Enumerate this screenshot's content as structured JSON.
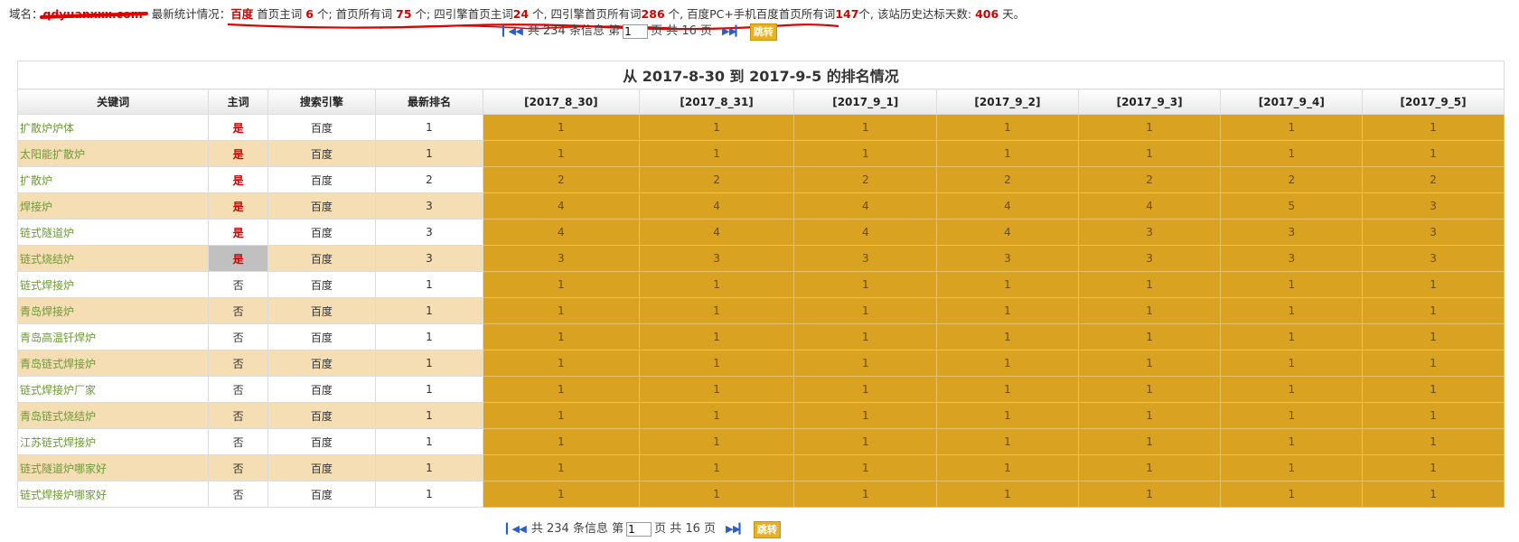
{
  "stats": {
    "domain_label": "域名：",
    "domain_value": "qdyuanxxx.com",
    "latest_label": "最新统计情况：",
    "engine": "百度",
    "seg1_text": "首页主词",
    "seg1_value": "6",
    "seg1_unit": "个; 首页所有词",
    "seg2_value": "75",
    "seg2_unit": "个; 四引擎首页主词",
    "seg3_value": "24",
    "seg3_unit": "个, 四引擎首页所有词",
    "seg4_value": "286",
    "seg4_unit": "个, 百度PC+手机百度首页所有词",
    "seg5_value": "147",
    "seg5_unit": "个, 该站历史达标天数:",
    "days_value": "406",
    "days_unit": "天。"
  },
  "pager": {
    "total_prefix": "共 234 条信息 第",
    "page_value": "1",
    "page_suffix": "页 共 16 页",
    "go_label": "跳转"
  },
  "table": {
    "caption": "从 2017-8-30 到 2017-9-5 的排名情况",
    "headers": [
      "关键词",
      "主词",
      "搜索引擎",
      "最新排名",
      "[2017_8_30]",
      "[2017_8_31]",
      "[2017_9_1]",
      "[2017_9_2]",
      "[2017_9_3]",
      "[2017_9_4]",
      "[2017_9_5]"
    ],
    "rows": [
      {
        "keyword": "扩散炉炉体",
        "main": "是",
        "engine": "百度",
        "latest": "1",
        "days": [
          "1",
          "1",
          "1",
          "1",
          "1",
          "1",
          "1"
        ]
      },
      {
        "keyword": "太阳能扩散炉",
        "main": "是",
        "engine": "百度",
        "latest": "1",
        "days": [
          "1",
          "1",
          "1",
          "1",
          "1",
          "1",
          "1"
        ]
      },
      {
        "keyword": "扩散炉",
        "main": "是",
        "engine": "百度",
        "latest": "2",
        "days": [
          "2",
          "2",
          "2",
          "2",
          "2",
          "2",
          "2"
        ]
      },
      {
        "keyword": "焊接炉",
        "main": "是",
        "engine": "百度",
        "latest": "3",
        "days": [
          "4",
          "4",
          "4",
          "4",
          "4",
          "5",
          "3"
        ]
      },
      {
        "keyword": "链式隧道炉",
        "main": "是",
        "engine": "百度",
        "latest": "3",
        "days": [
          "4",
          "4",
          "4",
          "4",
          "3",
          "3",
          "3"
        ]
      },
      {
        "keyword": "链式烧结炉",
        "main": "是",
        "engine": "百度",
        "latest": "3",
        "days": [
          "3",
          "3",
          "3",
          "3",
          "3",
          "3",
          "3"
        ]
      },
      {
        "keyword": "链式焊接炉",
        "main": "否",
        "engine": "百度",
        "latest": "1",
        "days": [
          "1",
          "1",
          "1",
          "1",
          "1",
          "1",
          "1"
        ]
      },
      {
        "keyword": "青岛焊接炉",
        "main": "否",
        "engine": "百度",
        "latest": "1",
        "days": [
          "1",
          "1",
          "1",
          "1",
          "1",
          "1",
          "1"
        ]
      },
      {
        "keyword": "青岛高温钎焊炉",
        "main": "否",
        "engine": "百度",
        "latest": "1",
        "days": [
          "1",
          "1",
          "1",
          "1",
          "1",
          "1",
          "1"
        ]
      },
      {
        "keyword": "青岛链式焊接炉",
        "main": "否",
        "engine": "百度",
        "latest": "1",
        "days": [
          "1",
          "1",
          "1",
          "1",
          "1",
          "1",
          "1"
        ]
      },
      {
        "keyword": "链式焊接炉厂家",
        "main": "否",
        "engine": "百度",
        "latest": "1",
        "days": [
          "1",
          "1",
          "1",
          "1",
          "1",
          "1",
          "1"
        ]
      },
      {
        "keyword": "青岛链式烧结炉",
        "main": "否",
        "engine": "百度",
        "latest": "1",
        "days": [
          "1",
          "1",
          "1",
          "1",
          "1",
          "1",
          "1"
        ]
      },
      {
        "keyword": "江苏链式焊接炉",
        "main": "否",
        "engine": "百度",
        "latest": "1",
        "days": [
          "1",
          "1",
          "1",
          "1",
          "1",
          "1",
          "1"
        ]
      },
      {
        "keyword": "链式隧道炉哪家好",
        "main": "否",
        "engine": "百度",
        "latest": "1",
        "days": [
          "1",
          "1",
          "1",
          "1",
          "1",
          "1",
          "1"
        ]
      },
      {
        "keyword": "链式焊接炉哪家好",
        "main": "否",
        "engine": "百度",
        "latest": "1",
        "days": [
          "1",
          "1",
          "1",
          "1",
          "1",
          "1",
          "1"
        ]
      }
    ]
  },
  "colors": {
    "accent_red": "#d40000",
    "rank_cell": "#d9a321",
    "alt_row": "#f5deb3",
    "keyword_green": "#6e9a3a"
  }
}
